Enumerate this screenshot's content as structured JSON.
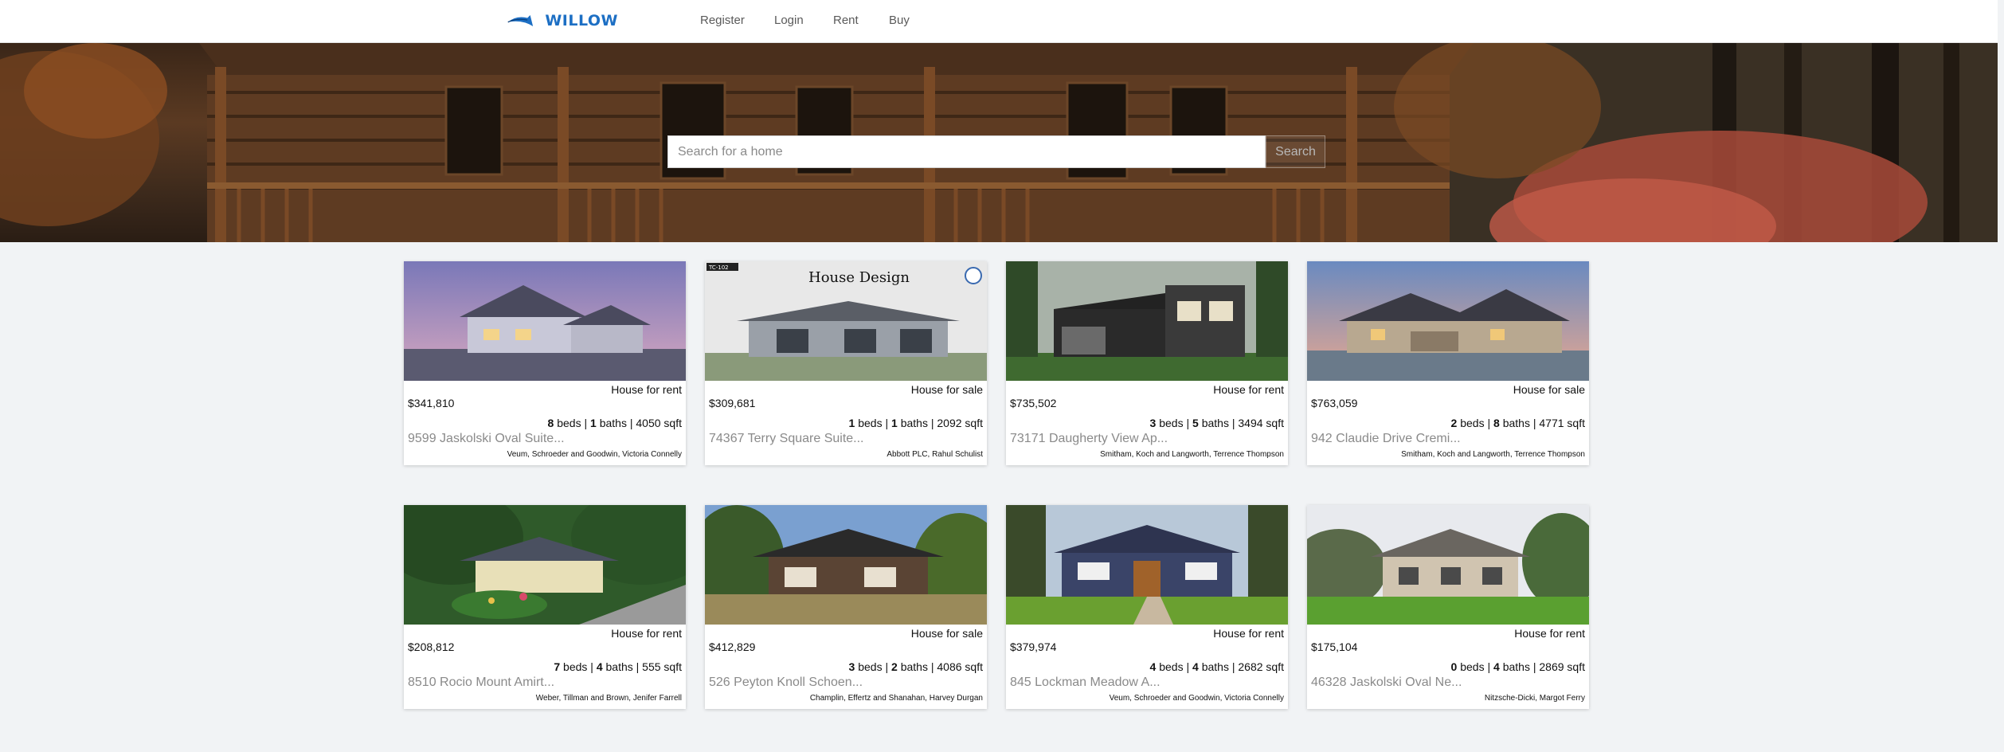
{
  "brand": {
    "name": "WILLOW",
    "accent": "#1d6fc4"
  },
  "nav": {
    "register": "Register",
    "login": "Login",
    "rent": "Rent",
    "buy": "Buy"
  },
  "search": {
    "placeholder": "Search for a home",
    "button": "Search"
  },
  "listings": [
    {
      "type": "House for rent",
      "price": "$341,810",
      "beds": "8",
      "baths": "1",
      "sqft": "4050",
      "address": "9599 Jaskolski Oval Suite...",
      "agent": "Veum, Schroeder and Goodwin, Victoria Connelly"
    },
    {
      "type": "House for sale",
      "price": "$309,681",
      "beds": "1",
      "baths": "1",
      "sqft": "2092",
      "address": "74367 Terry Square Suite...",
      "agent": "Abbott PLC, Rahul Schulist",
      "image_caption": "House Design",
      "image_tag": "TC-102"
    },
    {
      "type": "House for rent",
      "price": "$735,502",
      "beds": "3",
      "baths": "5",
      "sqft": "3494",
      "address": "73171 Daugherty View Ap...",
      "agent": "Smitham, Koch and Langworth, Terrence Thompson"
    },
    {
      "type": "House for sale",
      "price": "$763,059",
      "beds": "2",
      "baths": "8",
      "sqft": "4771",
      "address": "942 Claudie Drive Cremi...",
      "agent": "Smitham, Koch and Langworth, Terrence Thompson"
    },
    {
      "type": "House for rent",
      "price": "$208,812",
      "beds": "7",
      "baths": "4",
      "sqft": "555",
      "address": "8510 Rocio Mount Amirt...",
      "agent": "Weber, Tillman and Brown, Jenifer Farrell"
    },
    {
      "type": "House for sale",
      "price": "$412,829",
      "beds": "3",
      "baths": "2",
      "sqft": "4086",
      "address": "526 Peyton Knoll Schoen...",
      "agent": "Champlin, Effertz and Shanahan, Harvey Durgan"
    },
    {
      "type": "House for rent",
      "price": "$379,974",
      "beds": "4",
      "baths": "4",
      "sqft": "2682",
      "address": "845 Lockman Meadow A...",
      "agent": "Veum, Schroeder and Goodwin, Victoria Connelly"
    },
    {
      "type": "House for rent",
      "price": "$175,104",
      "beds": "0",
      "baths": "4",
      "sqft": "2869",
      "address": "46328 Jaskolski Oval Ne...",
      "agent": "Nitzsche-Dicki, Margot Ferry"
    }
  ],
  "labels": {
    "beds": "beds",
    "baths": "baths",
    "sqft": "sqft",
    "sep": "|"
  }
}
